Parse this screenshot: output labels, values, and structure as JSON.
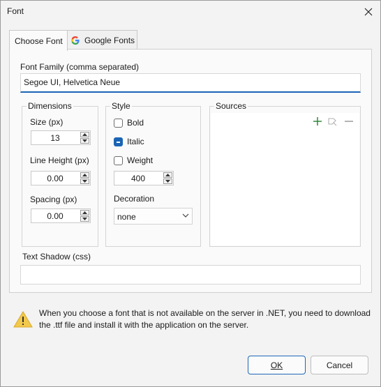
{
  "window": {
    "title": "Font"
  },
  "tabs": [
    {
      "label": "Choose Font",
      "active": true
    },
    {
      "label": "Google Fonts",
      "active": false
    }
  ],
  "font_family": {
    "label": "Font Family (comma separated)",
    "value": "Segoe UI, Helvetica Neue"
  },
  "dimensions": {
    "title": "Dimensions",
    "size_label": "Size (px)",
    "size_value": "13",
    "line_height_label": "Line Height (px)",
    "line_height_value": "0.00",
    "spacing_label": "Spacing (px)",
    "spacing_value": "0.00"
  },
  "style": {
    "title": "Style",
    "bold_label": "Bold",
    "bold_checked": false,
    "italic_label": "Italic",
    "italic_checked": true,
    "weight_label": "Weight",
    "weight_checked": false,
    "weight_value": "400",
    "decoration_label": "Decoration",
    "decoration_value": "none"
  },
  "sources": {
    "title": "Sources",
    "icons": [
      "add-icon",
      "brush-icon",
      "remove-icon"
    ]
  },
  "text_shadow": {
    "label": "Text Shadow (css)",
    "value": ""
  },
  "note": {
    "text": "When you choose a font that is not available on the server in .NET, you need to download the .ttf file and install it with the application on the server."
  },
  "buttons": {
    "ok_label": "OK",
    "cancel_label": "Cancel"
  },
  "colors": {
    "accent": "#1a64b4",
    "add_icon": "#2e8b3a",
    "warning": "#f2c94c"
  }
}
